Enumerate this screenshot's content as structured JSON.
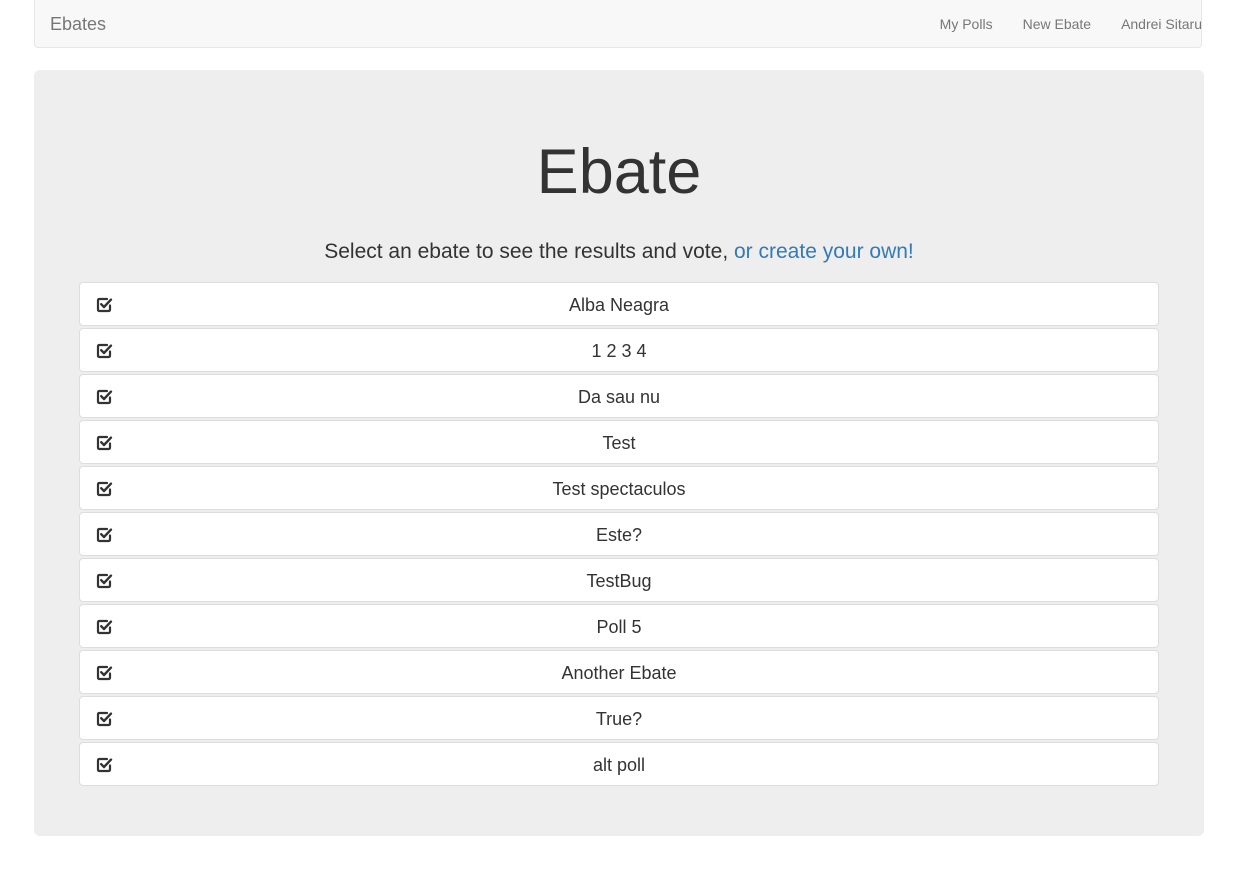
{
  "navbar": {
    "brand": "Ebates",
    "links": [
      "My Polls",
      "New Ebate",
      "Andrei Sitaru"
    ]
  },
  "jumbotron": {
    "title": "Ebate",
    "subtitle_text": "Select an ebate to see the results and vote, ",
    "subtitle_link": "or create your own!"
  },
  "polls": [
    {
      "label": "Alba Neagra",
      "icon": "check-square-icon"
    },
    {
      "label": "1 2 3 4",
      "icon": "check-square-icon"
    },
    {
      "label": "Da sau nu",
      "icon": "check-square-icon"
    },
    {
      "label": "Test",
      "icon": "check-square-icon"
    },
    {
      "label": "Test spectaculos",
      "icon": "check-square-icon"
    },
    {
      "label": "Este?",
      "icon": "check-square-icon"
    },
    {
      "label": "TestBug",
      "icon": "check-square-icon"
    },
    {
      "label": "Poll 5",
      "icon": "check-square-icon"
    },
    {
      "label": "Another Ebate",
      "icon": "check-square-icon"
    },
    {
      "label": "True?",
      "icon": "check-square-icon"
    },
    {
      "label": "alt poll",
      "icon": "check-square-icon"
    }
  ],
  "colors": {
    "link": "#337ab7",
    "jumbotron_bg": "#eeeeee",
    "navbar_bg": "#f8f8f8"
  }
}
